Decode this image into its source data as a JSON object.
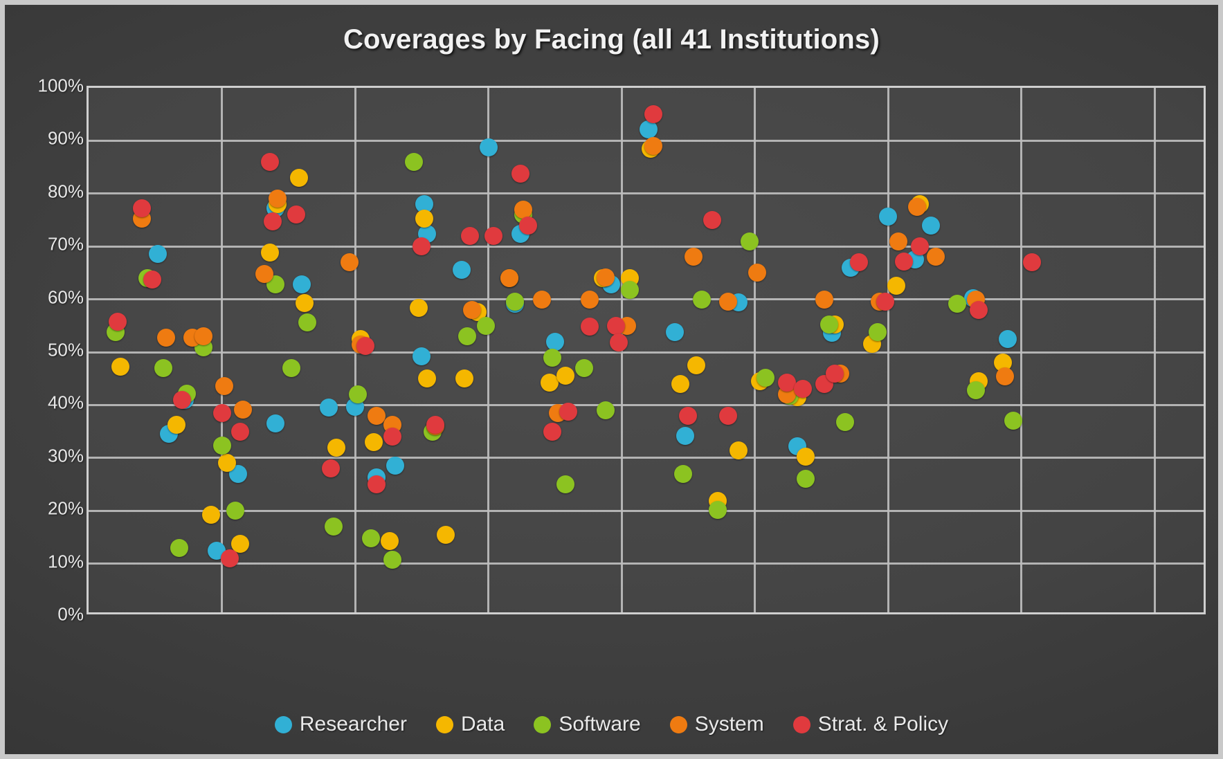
{
  "chart": {
    "title": "Coverages by Facing (all 41 Institutions)",
    "background_color": "#3d3d3d",
    "border_color": "#c9c9c9",
    "gridline_color": "#bdbdbd",
    "text_color": "#f2f2f2"
  },
  "legend": {
    "position": "bottom",
    "items": [
      {
        "label": "Researcher",
        "color": "#31b0d5"
      },
      {
        "label": "Data",
        "color": "#f5b700"
      },
      {
        "label": "Software",
        "color": "#8cc321"
      },
      {
        "label": "System",
        "color": "#ef7b11"
      },
      {
        "label": "Strat. & Policy",
        "color": "#e03a3e"
      }
    ]
  },
  "chart_data": {
    "type": "scatter",
    "title": "Coverages by Facing (all 41 Institutions)",
    "xlabel": "",
    "ylabel": "",
    "ylim": [
      0,
      100
    ],
    "xlim": [
      0,
      42
    ],
    "grid": true,
    "legend_position": "bottom",
    "y_ticks": [
      "0%",
      "10%",
      "20%",
      "30%",
      "40%",
      "50%",
      "60%",
      "70%",
      "80%",
      "90%",
      "100%"
    ],
    "y_tick_values": [
      0,
      10,
      20,
      30,
      40,
      50,
      60,
      70,
      80,
      90,
      100
    ],
    "x_tick_labels": [],
    "x_gridline_values": [
      0,
      5,
      10,
      15,
      20,
      25,
      30,
      35,
      40,
      42
    ],
    "series": [
      {
        "name": "Researcher",
        "color": "#31b0d5",
        "points": [
          {
            "x": 2.6,
            "y": 68.6
          },
          {
            "x": 3.0,
            "y": 34.5
          },
          {
            "x": 3.6,
            "y": 41.0
          },
          {
            "x": 4.8,
            "y": 12.5
          },
          {
            "x": 5.6,
            "y": 27.0
          },
          {
            "x": 7.0,
            "y": 77.2
          },
          {
            "x": 7.0,
            "y": 36.5
          },
          {
            "x": 8.0,
            "y": 62.8
          },
          {
            "x": 9.0,
            "y": 39.5
          },
          {
            "x": 10.0,
            "y": 39.6
          },
          {
            "x": 10.8,
            "y": 26.3
          },
          {
            "x": 11.5,
            "y": 28.5
          },
          {
            "x": 12.5,
            "y": 49.2
          },
          {
            "x": 12.6,
            "y": 78.0
          },
          {
            "x": 12.7,
            "y": 72.4
          },
          {
            "x": 14.0,
            "y": 65.6
          },
          {
            "x": 15.0,
            "y": 88.8
          },
          {
            "x": 16.0,
            "y": 59.2
          },
          {
            "x": 16.2,
            "y": 72.4
          },
          {
            "x": 17.5,
            "y": 52.0
          },
          {
            "x": 19.6,
            "y": 62.8
          },
          {
            "x": 21.0,
            "y": 92.2
          },
          {
            "x": 22.0,
            "y": 53.8
          },
          {
            "x": 22.4,
            "y": 34.2
          },
          {
            "x": 24.4,
            "y": 59.4
          },
          {
            "x": 26.6,
            "y": 32.2
          },
          {
            "x": 27.9,
            "y": 53.6
          },
          {
            "x": 28.6,
            "y": 66.0
          },
          {
            "x": 30.0,
            "y": 75.6
          },
          {
            "x": 31.0,
            "y": 67.6
          },
          {
            "x": 31.6,
            "y": 74.0
          },
          {
            "x": 33.2,
            "y": 60.2
          },
          {
            "x": 34.5,
            "y": 52.5
          }
        ]
      },
      {
        "name": "Data",
        "color": "#f5b700",
        "points": [
          {
            "x": 1.2,
            "y": 47.2
          },
          {
            "x": 3.3,
            "y": 36.3
          },
          {
            "x": 4.6,
            "y": 19.3
          },
          {
            "x": 5.2,
            "y": 29.0
          },
          {
            "x": 5.7,
            "y": 13.8
          },
          {
            "x": 6.8,
            "y": 68.8
          },
          {
            "x": 7.1,
            "y": 78.0
          },
          {
            "x": 7.9,
            "y": 83.0
          },
          {
            "x": 8.1,
            "y": 59.3
          },
          {
            "x": 9.3,
            "y": 32.0
          },
          {
            "x": 10.2,
            "y": 52.5
          },
          {
            "x": 10.7,
            "y": 33.0
          },
          {
            "x": 11.3,
            "y": 14.3
          },
          {
            "x": 12.4,
            "y": 58.4
          },
          {
            "x": 12.6,
            "y": 75.2
          },
          {
            "x": 12.7,
            "y": 45.0
          },
          {
            "x": 13.4,
            "y": 15.4
          },
          {
            "x": 14.1,
            "y": 45.0
          },
          {
            "x": 14.6,
            "y": 57.6
          },
          {
            "x": 15.8,
            "y": 64.0
          },
          {
            "x": 17.3,
            "y": 44.2
          },
          {
            "x": 17.9,
            "y": 45.5
          },
          {
            "x": 19.3,
            "y": 64.0
          },
          {
            "x": 20.3,
            "y": 64.0
          },
          {
            "x": 21.1,
            "y": 88.5
          },
          {
            "x": 22.2,
            "y": 44.0
          },
          {
            "x": 22.8,
            "y": 47.5
          },
          {
            "x": 23.6,
            "y": 21.8
          },
          {
            "x": 24.4,
            "y": 31.4
          },
          {
            "x": 25.2,
            "y": 44.5
          },
          {
            "x": 26.6,
            "y": 41.5
          },
          {
            "x": 26.9,
            "y": 30.2
          },
          {
            "x": 28.0,
            "y": 55.2
          },
          {
            "x": 29.4,
            "y": 51.6
          },
          {
            "x": 30.3,
            "y": 62.6
          },
          {
            "x": 31.2,
            "y": 78.0
          },
          {
            "x": 33.4,
            "y": 44.5
          },
          {
            "x": 34.3,
            "y": 48.0
          }
        ]
      },
      {
        "name": "Software",
        "color": "#8cc321",
        "points": [
          {
            "x": 1.0,
            "y": 53.8
          },
          {
            "x": 2.2,
            "y": 64.0
          },
          {
            "x": 2.8,
            "y": 47.0
          },
          {
            "x": 3.4,
            "y": 12.9
          },
          {
            "x": 3.7,
            "y": 42.2
          },
          {
            "x": 4.3,
            "y": 50.9
          },
          {
            "x": 5.0,
            "y": 32.3
          },
          {
            "x": 5.5,
            "y": 20.0
          },
          {
            "x": 7.0,
            "y": 62.8
          },
          {
            "x": 7.6,
            "y": 47.0
          },
          {
            "x": 8.2,
            "y": 55.6
          },
          {
            "x": 9.2,
            "y": 17.0
          },
          {
            "x": 10.1,
            "y": 42.0
          },
          {
            "x": 10.6,
            "y": 14.8
          },
          {
            "x": 11.4,
            "y": 10.7
          },
          {
            "x": 12.2,
            "y": 86.0
          },
          {
            "x": 12.9,
            "y": 34.9
          },
          {
            "x": 14.2,
            "y": 53.0
          },
          {
            "x": 14.9,
            "y": 55.0
          },
          {
            "x": 16.0,
            "y": 59.5
          },
          {
            "x": 16.3,
            "y": 76.0
          },
          {
            "x": 17.4,
            "y": 49.0
          },
          {
            "x": 17.9,
            "y": 25.0
          },
          {
            "x": 18.6,
            "y": 47.0
          },
          {
            "x": 19.4,
            "y": 39.0
          },
          {
            "x": 20.3,
            "y": 61.8
          },
          {
            "x": 22.3,
            "y": 27.0
          },
          {
            "x": 23.0,
            "y": 60.0
          },
          {
            "x": 23.6,
            "y": 20.2
          },
          {
            "x": 24.8,
            "y": 71.0
          },
          {
            "x": 25.4,
            "y": 45.2
          },
          {
            "x": 26.3,
            "y": 41.7
          },
          {
            "x": 26.9,
            "y": 26.0
          },
          {
            "x": 27.8,
            "y": 55.3
          },
          {
            "x": 28.4,
            "y": 36.8
          },
          {
            "x": 29.6,
            "y": 53.8
          },
          {
            "x": 32.6,
            "y": 59.2
          },
          {
            "x": 33.3,
            "y": 42.8
          },
          {
            "x": 34.7,
            "y": 37.0
          }
        ]
      },
      {
        "name": "System",
        "color": "#ef7b11",
        "points": [
          {
            "x": 2.0,
            "y": 75.2
          },
          {
            "x": 2.9,
            "y": 52.7
          },
          {
            "x": 3.9,
            "y": 52.8
          },
          {
            "x": 4.3,
            "y": 53.0
          },
          {
            "x": 5.1,
            "y": 43.6
          },
          {
            "x": 5.8,
            "y": 39.2
          },
          {
            "x": 6.6,
            "y": 64.8
          },
          {
            "x": 7.1,
            "y": 79.0
          },
          {
            "x": 9.8,
            "y": 67.0
          },
          {
            "x": 10.2,
            "y": 51.5
          },
          {
            "x": 10.8,
            "y": 38.0
          },
          {
            "x": 11.4,
            "y": 36.2
          },
          {
            "x": 13.0,
            "y": 36.0
          },
          {
            "x": 14.4,
            "y": 58.0
          },
          {
            "x": 15.8,
            "y": 64.0
          },
          {
            "x": 16.3,
            "y": 77.0
          },
          {
            "x": 17.0,
            "y": 60.0
          },
          {
            "x": 17.6,
            "y": 38.5
          },
          {
            "x": 18.8,
            "y": 60.0
          },
          {
            "x": 19.4,
            "y": 64.2
          },
          {
            "x": 20.2,
            "y": 55.0
          },
          {
            "x": 21.2,
            "y": 89.0
          },
          {
            "x": 22.7,
            "y": 68.0
          },
          {
            "x": 24.0,
            "y": 59.5
          },
          {
            "x": 25.1,
            "y": 65.0
          },
          {
            "x": 26.2,
            "y": 42.0
          },
          {
            "x": 27.6,
            "y": 60.0
          },
          {
            "x": 28.2,
            "y": 46.0
          },
          {
            "x": 29.7,
            "y": 59.6
          },
          {
            "x": 30.4,
            "y": 71.0
          },
          {
            "x": 31.1,
            "y": 77.5
          },
          {
            "x": 31.8,
            "y": 68.0
          },
          {
            "x": 33.3,
            "y": 60.0
          },
          {
            "x": 34.4,
            "y": 45.4
          }
        ]
      },
      {
        "name": "Strat. & Policy",
        "color": "#e03a3e",
        "points": [
          {
            "x": 1.1,
            "y": 55.8
          },
          {
            "x": 2.0,
            "y": 77.2
          },
          {
            "x": 2.4,
            "y": 63.8
          },
          {
            "x": 3.5,
            "y": 41.0
          },
          {
            "x": 5.0,
            "y": 38.5
          },
          {
            "x": 5.3,
            "y": 11.0
          },
          {
            "x": 5.7,
            "y": 35.0
          },
          {
            "x": 6.8,
            "y": 86.0
          },
          {
            "x": 6.9,
            "y": 74.8
          },
          {
            "x": 7.8,
            "y": 76.0
          },
          {
            "x": 9.1,
            "y": 28.0
          },
          {
            "x": 10.4,
            "y": 51.2
          },
          {
            "x": 10.8,
            "y": 25.0
          },
          {
            "x": 11.4,
            "y": 34.0
          },
          {
            "x": 12.5,
            "y": 70.0
          },
          {
            "x": 13.0,
            "y": 36.2
          },
          {
            "x": 14.3,
            "y": 72.0
          },
          {
            "x": 15.2,
            "y": 72.0
          },
          {
            "x": 16.2,
            "y": 83.8
          },
          {
            "x": 16.5,
            "y": 74.0
          },
          {
            "x": 17.4,
            "y": 35.0
          },
          {
            "x": 18.0,
            "y": 38.8
          },
          {
            "x": 18.8,
            "y": 54.8
          },
          {
            "x": 19.8,
            "y": 55.0
          },
          {
            "x": 19.9,
            "y": 51.8
          },
          {
            "x": 21.2,
            "y": 95.0
          },
          {
            "x": 22.5,
            "y": 38.0
          },
          {
            "x": 23.4,
            "y": 75.0
          },
          {
            "x": 24.0,
            "y": 38.0
          },
          {
            "x": 26.2,
            "y": 44.2
          },
          {
            "x": 26.8,
            "y": 43.0
          },
          {
            "x": 27.6,
            "y": 44.0
          },
          {
            "x": 28.0,
            "y": 46.0
          },
          {
            "x": 28.9,
            "y": 67.0
          },
          {
            "x": 29.9,
            "y": 59.6
          },
          {
            "x": 30.6,
            "y": 67.2
          },
          {
            "x": 31.2,
            "y": 70.0
          },
          {
            "x": 33.4,
            "y": 58.0
          },
          {
            "x": 35.4,
            "y": 67.0
          }
        ]
      }
    ]
  }
}
